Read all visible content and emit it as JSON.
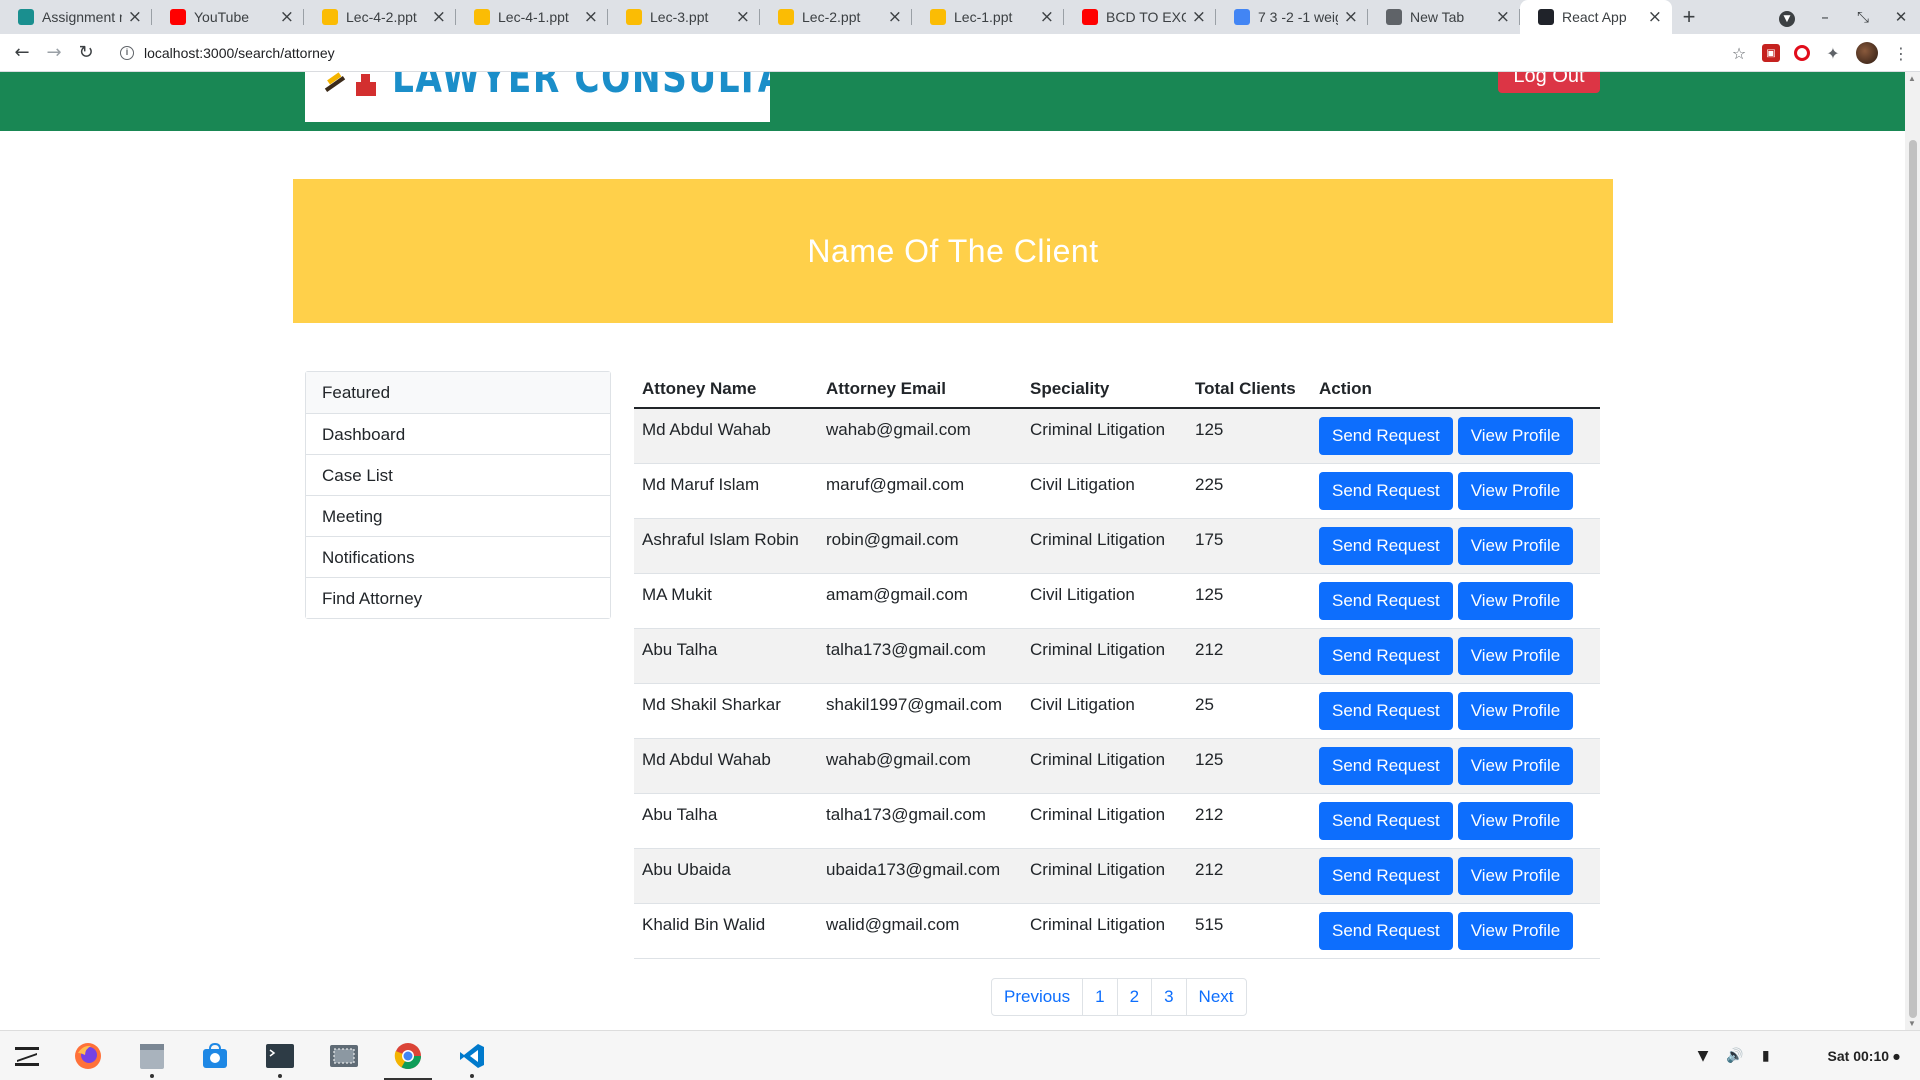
{
  "browser": {
    "tabs": [
      {
        "label": "Assignment n",
        "favicon_color": "#1a8f8f",
        "icon": "classroom-icon"
      },
      {
        "label": "YouTube",
        "favicon_color": "#ff0000",
        "icon": "youtube-icon"
      },
      {
        "label": "Lec-4-2.ppt",
        "favicon_color": "#fbbc04",
        "icon": "drive-icon"
      },
      {
        "label": "Lec-4-1.ppt",
        "favicon_color": "#fbbc04",
        "icon": "drive-icon"
      },
      {
        "label": "Lec-3.ppt",
        "favicon_color": "#fbbc04",
        "icon": "drive-icon"
      },
      {
        "label": "Lec-2.ppt",
        "favicon_color": "#fbbc04",
        "icon": "drive-icon"
      },
      {
        "label": "Lec-1.ppt",
        "favicon_color": "#fbbc04",
        "icon": "drive-icon"
      },
      {
        "label": "BCD TO EXCE",
        "favicon_color": "#ff0000",
        "icon": "youtube-icon"
      },
      {
        "label": "7 3 -2 -1 weig",
        "favicon_color": "#4285f4",
        "icon": "google-icon"
      },
      {
        "label": "New Tab",
        "favicon_color": "#5f6368",
        "icon": "chrome-icon"
      },
      {
        "label": "React App",
        "favicon_color": "#20232a",
        "icon": "react-icon",
        "active": true
      }
    ],
    "url": "localhost:3000/search/attorney"
  },
  "header": {
    "logo_text": "LAWYER CONSULTANCY",
    "logout_label": "Log Out"
  },
  "banner": {
    "title": "Name Of The Client"
  },
  "sidebar": {
    "items": [
      {
        "label": "Featured"
      },
      {
        "label": "Dashboard"
      },
      {
        "label": "Case List"
      },
      {
        "label": "Meeting"
      },
      {
        "label": "Notifications"
      },
      {
        "label": "Find Attorney"
      }
    ]
  },
  "table": {
    "headers": [
      "Attoney Name",
      "Attorney Email",
      "Speciality",
      "Total Clients",
      "Action"
    ],
    "send_label": "Send Request",
    "view_label": "View Profile",
    "rows": [
      {
        "name": "Md Abdul Wahab",
        "email": "wahab@gmail.com",
        "speciality": "Criminal Litigation",
        "clients": "125"
      },
      {
        "name": "Md Maruf Islam",
        "email": "maruf@gmail.com",
        "speciality": "Civil Litigation",
        "clients": "225"
      },
      {
        "name": "Ashraful Islam Robin",
        "email": "robin@gmail.com",
        "speciality": "Criminal Litigation",
        "clients": "175"
      },
      {
        "name": "MA Mukit",
        "email": "amam@gmail.com",
        "speciality": "Civil Litigation",
        "clients": "125"
      },
      {
        "name": "Abu Talha",
        "email": "talha173@gmail.com",
        "speciality": "Criminal Litigation",
        "clients": "212"
      },
      {
        "name": "Md Shakil Sharkar",
        "email": "shakil1997@gmail.com",
        "speciality": "Civil Litigation",
        "clients": "25"
      },
      {
        "name": "Md Abdul Wahab",
        "email": "wahab@gmail.com",
        "speciality": "Criminal Litigation",
        "clients": "125"
      },
      {
        "name": "Abu Talha",
        "email": "talha173@gmail.com",
        "speciality": "Criminal Litigation",
        "clients": "212"
      },
      {
        "name": "Abu Ubaida",
        "email": "ubaida173@gmail.com",
        "speciality": "Criminal Litigation",
        "clients": "212"
      },
      {
        "name": "Khalid Bin Walid",
        "email": "walid@gmail.com",
        "speciality": "Criminal Litigation",
        "clients": "515"
      }
    ]
  },
  "pagination": {
    "previous": "Previous",
    "pages": [
      "1",
      "2",
      "3"
    ],
    "next": "Next"
  },
  "taskbar": {
    "clock": "Sat 00:10",
    "apps": [
      "zorin-menu-icon",
      "firefox-icon",
      "files-icon",
      "software-store-icon",
      "terminal-icon",
      "screenshot-icon",
      "chrome-icon",
      "vscode-icon"
    ]
  },
  "colors": {
    "header_green": "#198754",
    "banner_yellow": "#ffd04a",
    "primary_blue": "#0d6efd",
    "logout_red": "#dc3545"
  }
}
